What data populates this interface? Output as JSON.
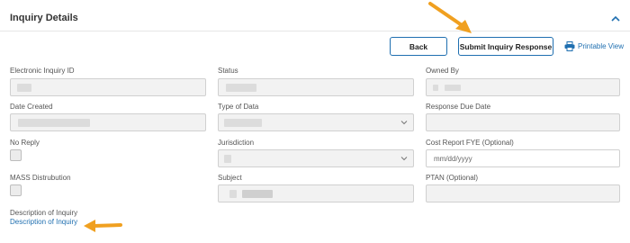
{
  "panel": {
    "title": "Inquiry Details",
    "collapse_icon": "chevron-up-icon",
    "accent_color": "#1f6fb0",
    "highlight_color": "#f0a020"
  },
  "actions": {
    "back_label": "Back",
    "submit_label": "Submit Inquiry Response",
    "printable_label": "Printable View",
    "printable_icon": "printer-icon"
  },
  "fields": {
    "electronic_inquiry_id": {
      "label": "Electronic Inquiry ID"
    },
    "status": {
      "label": "Status"
    },
    "owned_by": {
      "label": "Owned By"
    },
    "date_created": {
      "label": "Date Created"
    },
    "type_of_data": {
      "label": "Type of Data"
    },
    "response_due_date": {
      "label": "Response Due Date"
    },
    "no_reply": {
      "label": "No Reply",
      "checked": false
    },
    "jurisdiction": {
      "label": "Jurisdiction"
    },
    "cost_report_fye": {
      "label": "Cost Report FYE (Optional)",
      "placeholder": "mm/dd/yyyy"
    },
    "mass_distribution": {
      "label": "MASS Distrubution",
      "checked": false
    },
    "subject": {
      "label": "Subject"
    },
    "ptan": {
      "label": "PTAN (Optional)"
    },
    "description": {
      "label": "Description of Inquiry",
      "link_text": "Description of Inquiry"
    }
  }
}
